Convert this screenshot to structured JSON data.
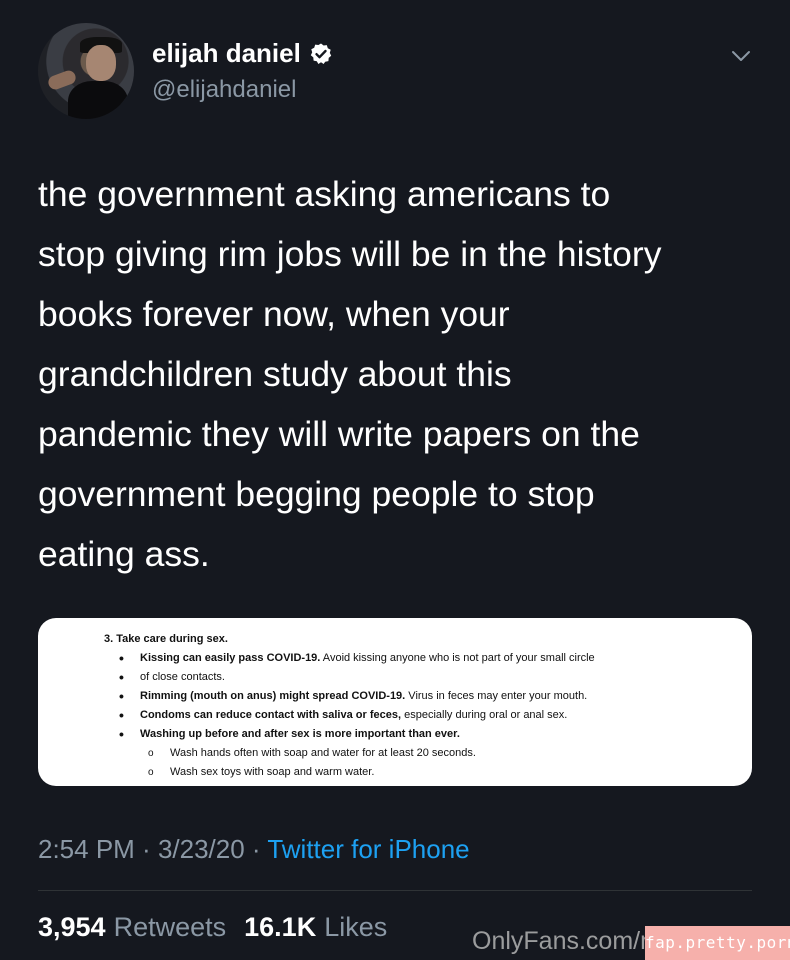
{
  "author": {
    "display_name": "elijah daniel",
    "handle": "@elijahdaniel",
    "verified_icon": "verified-badge-icon",
    "avatar_icon": "avatar-photo"
  },
  "tweet": {
    "text": "the government asking americans to\nstop giving rim jobs will be in the history\nbooks forever now, when your\ngrandchildren study about this\npandemic they will write papers on the\ngovernment begging people to stop\neating ass."
  },
  "attached_document": {
    "heading": "3. Take care during sex.",
    "bullets": [
      {
        "bold": "Kissing can easily pass COVID-19.",
        "rest": " Avoid kissing anyone who is not part of your small circle",
        "rest2": "of close contacts."
      },
      {
        "bold": "Rimming (mouth on anus) might spread COVID-19.",
        "rest": " Virus in feces may enter your mouth."
      },
      {
        "bold": "Condoms can reduce contact with saliva or feces,",
        "rest": " especially during oral or anal sex."
      },
      {
        "bold": "Washing up before and after sex is more important than ever.",
        "rest": ""
      }
    ],
    "sub_bullets": [
      "Wash hands often with soap and water for at least 20 seconds.",
      "Wash sex toys with soap and warm water."
    ]
  },
  "meta": {
    "time": "2:54 PM",
    "separator1": " · ",
    "date": "3/23/20",
    "separator2": " · ",
    "source": "Twitter for iPhone"
  },
  "stats": {
    "retweets_count": "3,954",
    "retweets_label": "Retweets",
    "likes_count": "16.1K",
    "likes_label": "Likes"
  },
  "watermarks": {
    "onlyfans": "OnlyFans.com/n",
    "site_badge": "fap.pretty.porn"
  },
  "colors": {
    "background": "#15181f",
    "secondary_text": "#8b98a5",
    "link": "#1da1f2",
    "verified": "#ffffff",
    "badge": "#f6b0ab"
  }
}
